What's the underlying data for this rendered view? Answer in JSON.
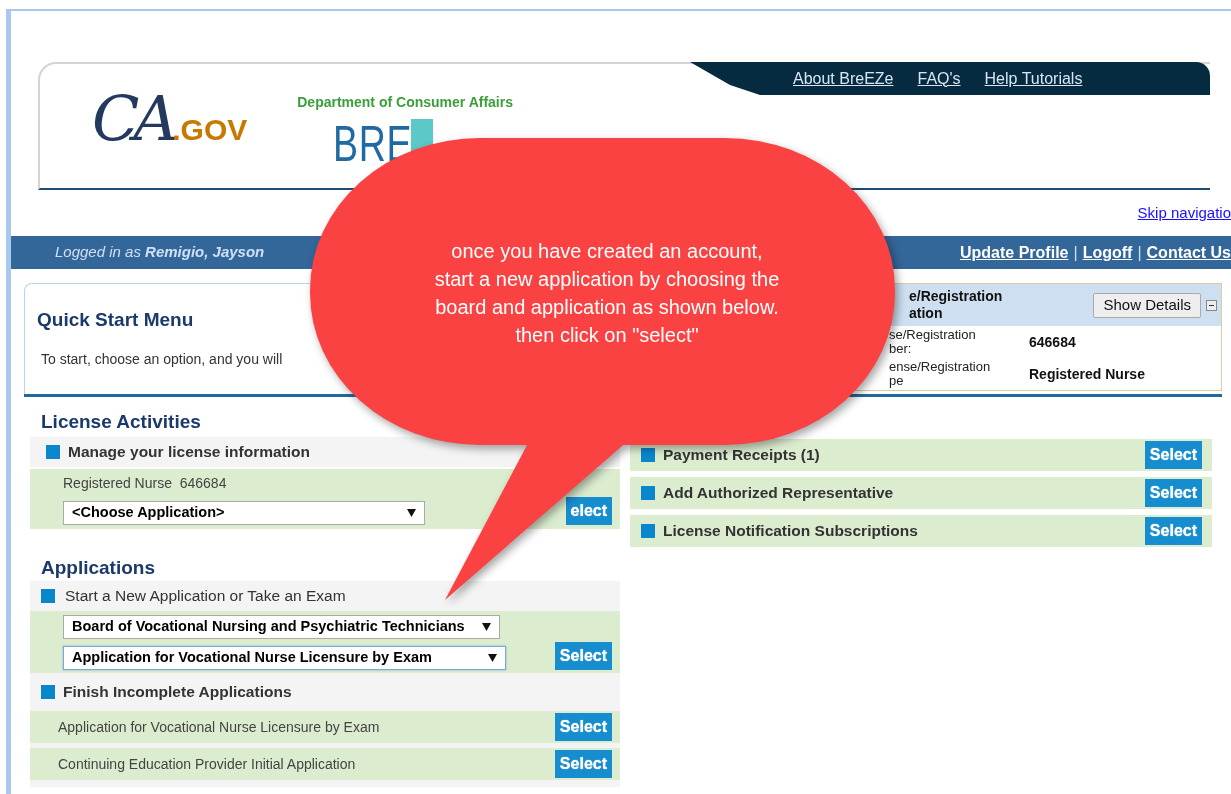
{
  "header": {
    "logo_ca": "CA",
    "logo_gov": ".GOV",
    "department": "Department of Consumer Affairs",
    "logo_breeze": "BRE",
    "nav_links": [
      "About BreEZe",
      "FAQ's",
      "Help Tutorials"
    ]
  },
  "skip_link": "Skip navigatio",
  "user_bar": {
    "logged_in_label": "Logged in as",
    "user_name": "Remigio, Jayson",
    "links": [
      "Update Profile",
      "Logoff",
      "Contact Us"
    ],
    "separators": [
      "|",
      "|"
    ]
  },
  "quick_start": {
    "title": "Quick Start Menu",
    "intro": "To start, choose an option, and you will"
  },
  "license_info": {
    "title_lines": [
      "e/Registration",
      "ation"
    ],
    "show_details": "Show Details",
    "rows": [
      {
        "label_lines": [
          "se/Registration",
          "ber:"
        ],
        "value": "646684"
      },
      {
        "label_lines": [
          "ense/Registration",
          "pe"
        ],
        "value": "Registered Nurse"
      }
    ]
  },
  "license_activities": {
    "title": "License Activities",
    "section": "Manage your license information",
    "license": "Registered Nurse  646684",
    "application_select": "<Choose Application>",
    "select_button": "elect"
  },
  "applications": {
    "title": "Applications",
    "new_section": "Start a New Application or Take an Exam",
    "board_select": {
      "value": "Board of Vocational Nursing and Psychiatric Technicians",
      "focused": false
    },
    "application_select": {
      "value": "Application for Vocational Nurse Licensure by Exam",
      "focused": true
    },
    "select_button": "Select",
    "incomplete_section": "Finish Incomplete Applications",
    "incomplete": [
      {
        "name": "Application for Vocational Nurse Licensure by Exam",
        "button": "Select"
      },
      {
        "name": "Continuing Education Provider Initial Application",
        "button": "Select"
      }
    ]
  },
  "other_actions": [
    {
      "label": "Payment Receipts (1)",
      "button": "Select"
    },
    {
      "label": "Add Authorized Representative",
      "button": "Select"
    },
    {
      "label": "License Notification Subscriptions",
      "button": "Select"
    }
  ],
  "callout": {
    "lines": [
      "once you have created an account,",
      "start a new application by choosing the",
      "board and application as shown below.",
      "then click on \"select\""
    ]
  }
}
